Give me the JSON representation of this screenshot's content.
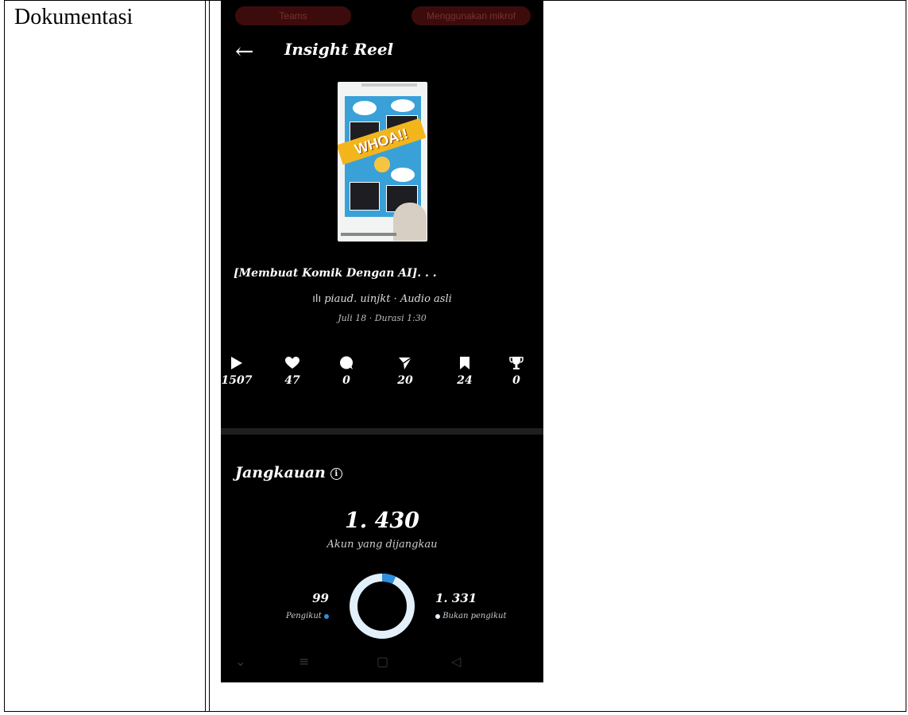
{
  "document": {
    "label": "Dokumentasi"
  },
  "screen": {
    "top_pills": {
      "left": "Teams",
      "right": "Menggunakan mikrof"
    },
    "header": {
      "back_glyph": "←",
      "title": "Insight Reel"
    },
    "post": {
      "title": "[Membuat Komik Dengan AI]. . .",
      "audio": "piaud. uinjkt · Audio asli",
      "date": "Juli 18 · Durasi 1:30",
      "thumbnail_text": "WHOA!!"
    },
    "stats": [
      {
        "icon": "play-icon",
        "value": "1507"
      },
      {
        "icon": "heart-icon",
        "value": "47"
      },
      {
        "icon": "comment-icon",
        "value": "0"
      },
      {
        "icon": "share-icon",
        "value": "20"
      },
      {
        "icon": "bookmark-icon",
        "value": "24"
      },
      {
        "icon": "trophy-icon",
        "value": "0"
      }
    ],
    "reach": {
      "title": "Jangkauan",
      "info_glyph": "i",
      "total": "1. 430",
      "total_label": "Akun yang dijangkau",
      "followers": {
        "value": "99",
        "label": "Pengikut",
        "count": 99,
        "color": "#2d8fe0"
      },
      "non_followers": {
        "value": "1. 331",
        "label": "Bukan pengikut",
        "count": 1331,
        "color": "#e3f0fa"
      }
    },
    "navbar": {
      "chevron": "⌄",
      "menu": "≡",
      "home": "▢",
      "back": "◁"
    }
  }
}
